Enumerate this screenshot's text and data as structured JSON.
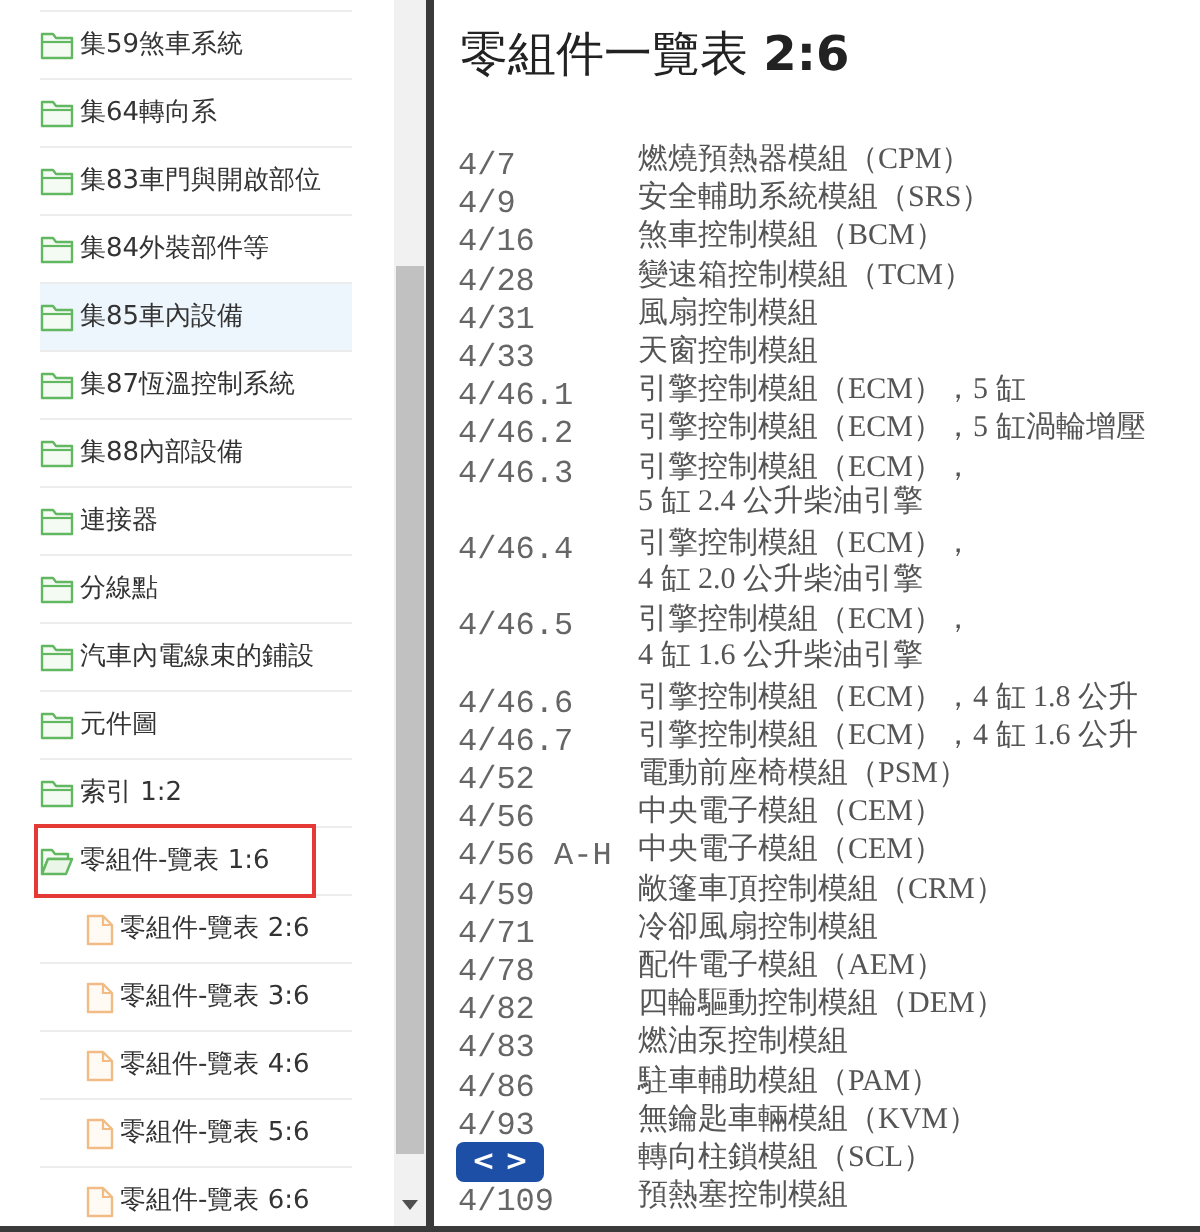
{
  "sidebar": {
    "items": [
      {
        "kind": "folder",
        "label": "集59煞車系統",
        "expanded": false,
        "hovered": false,
        "outlined": false
      },
      {
        "kind": "folder",
        "label": "集64轉向系",
        "expanded": false,
        "hovered": false,
        "outlined": false
      },
      {
        "kind": "folder",
        "label": "集83車門與開啟部位",
        "expanded": false,
        "hovered": false,
        "outlined": false
      },
      {
        "kind": "folder",
        "label": "集84外裝部件等",
        "expanded": false,
        "hovered": false,
        "outlined": false
      },
      {
        "kind": "folder",
        "label": "集85車內設備",
        "expanded": false,
        "hovered": true,
        "outlined": false
      },
      {
        "kind": "folder",
        "label": "集87恆溫控制系統",
        "expanded": false,
        "hovered": false,
        "outlined": false
      },
      {
        "kind": "folder",
        "label": "集88內部設備",
        "expanded": false,
        "hovered": false,
        "outlined": false
      },
      {
        "kind": "folder",
        "label": "連接器",
        "expanded": false,
        "hovered": false,
        "outlined": false
      },
      {
        "kind": "folder",
        "label": "分線點",
        "expanded": false,
        "hovered": false,
        "outlined": false
      },
      {
        "kind": "folder",
        "label": "汽車內電線束的鋪設",
        "expanded": false,
        "hovered": false,
        "outlined": false
      },
      {
        "kind": "folder",
        "label": "元件圖",
        "expanded": false,
        "hovered": false,
        "outlined": false
      },
      {
        "kind": "folder",
        "label": "索引 1:2",
        "expanded": false,
        "hovered": false,
        "outlined": false
      },
      {
        "kind": "folder",
        "label": "零組件-覽表 1:6",
        "expanded": true,
        "hovered": false,
        "outlined": true,
        "children": [
          {
            "kind": "file",
            "label": "零組件-覽表 2:6",
            "hovered": false,
            "outlined": false
          },
          {
            "kind": "file",
            "label": "零組件-覽表 3:6",
            "hovered": false,
            "outlined": false
          },
          {
            "kind": "file",
            "label": "零組件-覽表 4:6",
            "hovered": false,
            "outlined": false
          },
          {
            "kind": "file",
            "label": "零組件-覽表 5:6",
            "hovered": false,
            "outlined": false
          },
          {
            "kind": "file",
            "label": "零組件-覽表 6:6",
            "hovered": false,
            "outlined": false
          }
        ]
      }
    ]
  },
  "document": {
    "title": "零組件一覽表 **2:6**",
    "entries": [
      {
        "code": "4/7",
        "description": "燃燒預熱器模組（CPM）"
      },
      {
        "code": "4/9",
        "description": "安全輔助系統模組（SRS）"
      },
      {
        "code": "4/16",
        "description": "煞車控制模組（BCM）"
      },
      {
        "code": "4/28",
        "description": "變速箱控制模組（TCM）"
      },
      {
        "code": "4/31",
        "description": "風扇控制模組"
      },
      {
        "code": "4/33",
        "description": "天窗控制模組"
      },
      {
        "code": "4/46.1",
        "description": "引擎控制模組（ECM），5 缸"
      },
      {
        "code": "4/46.2",
        "description": "引擎控制模組（ECM），5 缸渦輪增壓"
      },
      {
        "code": "4/46.3",
        "description": "引擎控制模組（ECM），\n5 缸 2.4 公升柴油引擎"
      },
      {
        "code": "4/46.4",
        "description": "引擎控制模組（ECM），\n4 缸 2.0 公升柴油引擎"
      },
      {
        "code": "4/46.5",
        "description": "引擎控制模組（ECM），\n4 缸 1.6 公升柴油引擎"
      },
      {
        "code": "4/46.6",
        "description": "引擎控制模組（ECM），4 缸 1.8 公升"
      },
      {
        "code": "4/46.7",
        "description": "引擎控制模組（ECM），4 缸 1.6 公升"
      },
      {
        "code": "4/52",
        "description": "電動前座椅模組（PSM）"
      },
      {
        "code": "4/56",
        "description": "中央電子模組（CEM）"
      },
      {
        "code": "4/56 A-H",
        "description": "中央電子模組（CEM）"
      },
      {
        "code": "4/59",
        "description": "敞篷車頂控制模組（CRM）"
      },
      {
        "code": "4/71",
        "description": "冷卻風扇控制模組"
      },
      {
        "code": "4/78",
        "description": "配件電子模組（AEM）"
      },
      {
        "code": "4/82",
        "description": "四輪驅動控制模組（DEM）"
      },
      {
        "code": "4/83",
        "description": "燃油泵控制模組"
      },
      {
        "code": "4/86",
        "description": "駐車輔助模組（PAM）"
      },
      {
        "code": "4/93",
        "description": "無鑰匙車輛模組（KVM）"
      },
      {
        "description": "轉向柱鎖模組（SCL）"
      },
      {
        "code": "4/109",
        "description": "預熱塞控制模組"
      }
    ]
  },
  "nav_button": {
    "label": "< >"
  }
}
